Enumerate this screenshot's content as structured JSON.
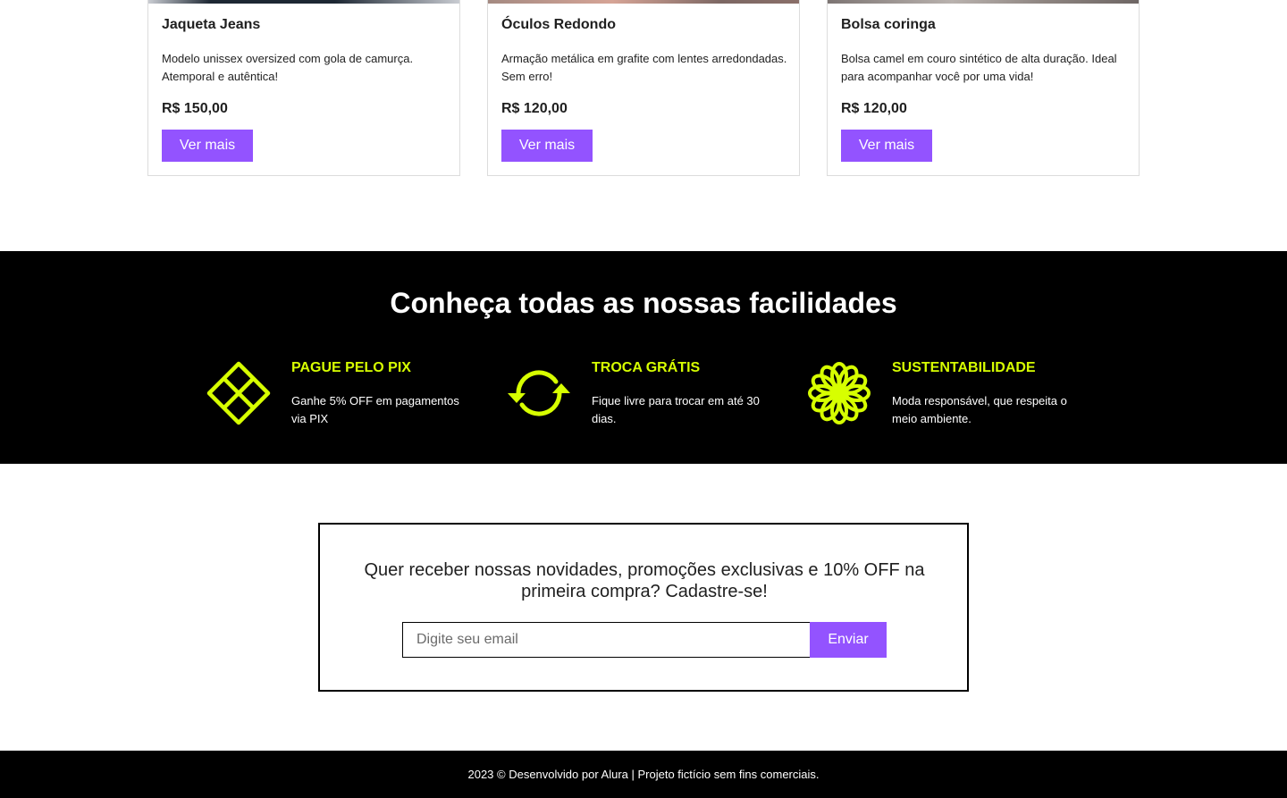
{
  "products": [
    {
      "name": "Jaqueta Jeans",
      "description": "Modelo unissex oversized com gola de camurça. Atemporal e autêntica!",
      "price": "R$ 150,00",
      "button": "Ver mais"
    },
    {
      "name": "Óculos Redondo",
      "description": "Armação metálica em grafite com lentes arredondadas. Sem erro!",
      "price": "R$ 120,00",
      "button": "Ver mais"
    },
    {
      "name": "Bolsa coringa",
      "description": "Bolsa camel em couro sintético de alta duração. Ideal para acompanhar você por uma vida!",
      "price": "R$ 120,00",
      "button": "Ver mais"
    }
  ],
  "features": {
    "title": "Conheça todas as nossas facilidades",
    "items": [
      {
        "icon": "pix-icon",
        "title": "PAGUE PELO PIX",
        "description": "Ganhe 5% OFF em pagamentos via PIX"
      },
      {
        "icon": "exchange-icon",
        "title": "TROCA GRÁTIS",
        "description": "Fique livre para trocar em até 30 dias."
      },
      {
        "icon": "flower-icon",
        "title": "SUSTENTABILIDADE",
        "description": "Moda responsável, que respeita o meio ambiente."
      }
    ]
  },
  "newsletter": {
    "text": "Quer receber nossas novidades, promoções exclusivas e 10% OFF na primeira compra? Cadastre-se!",
    "placeholder": "Digite seu email",
    "button": "Enviar"
  },
  "footer": {
    "text": "2023 © Desenvolvido por Alura | Projeto fictício sem fins comerciais."
  },
  "colors": {
    "accent": "#9353ff",
    "highlight": "#d7ff00",
    "dark": "#000000"
  }
}
